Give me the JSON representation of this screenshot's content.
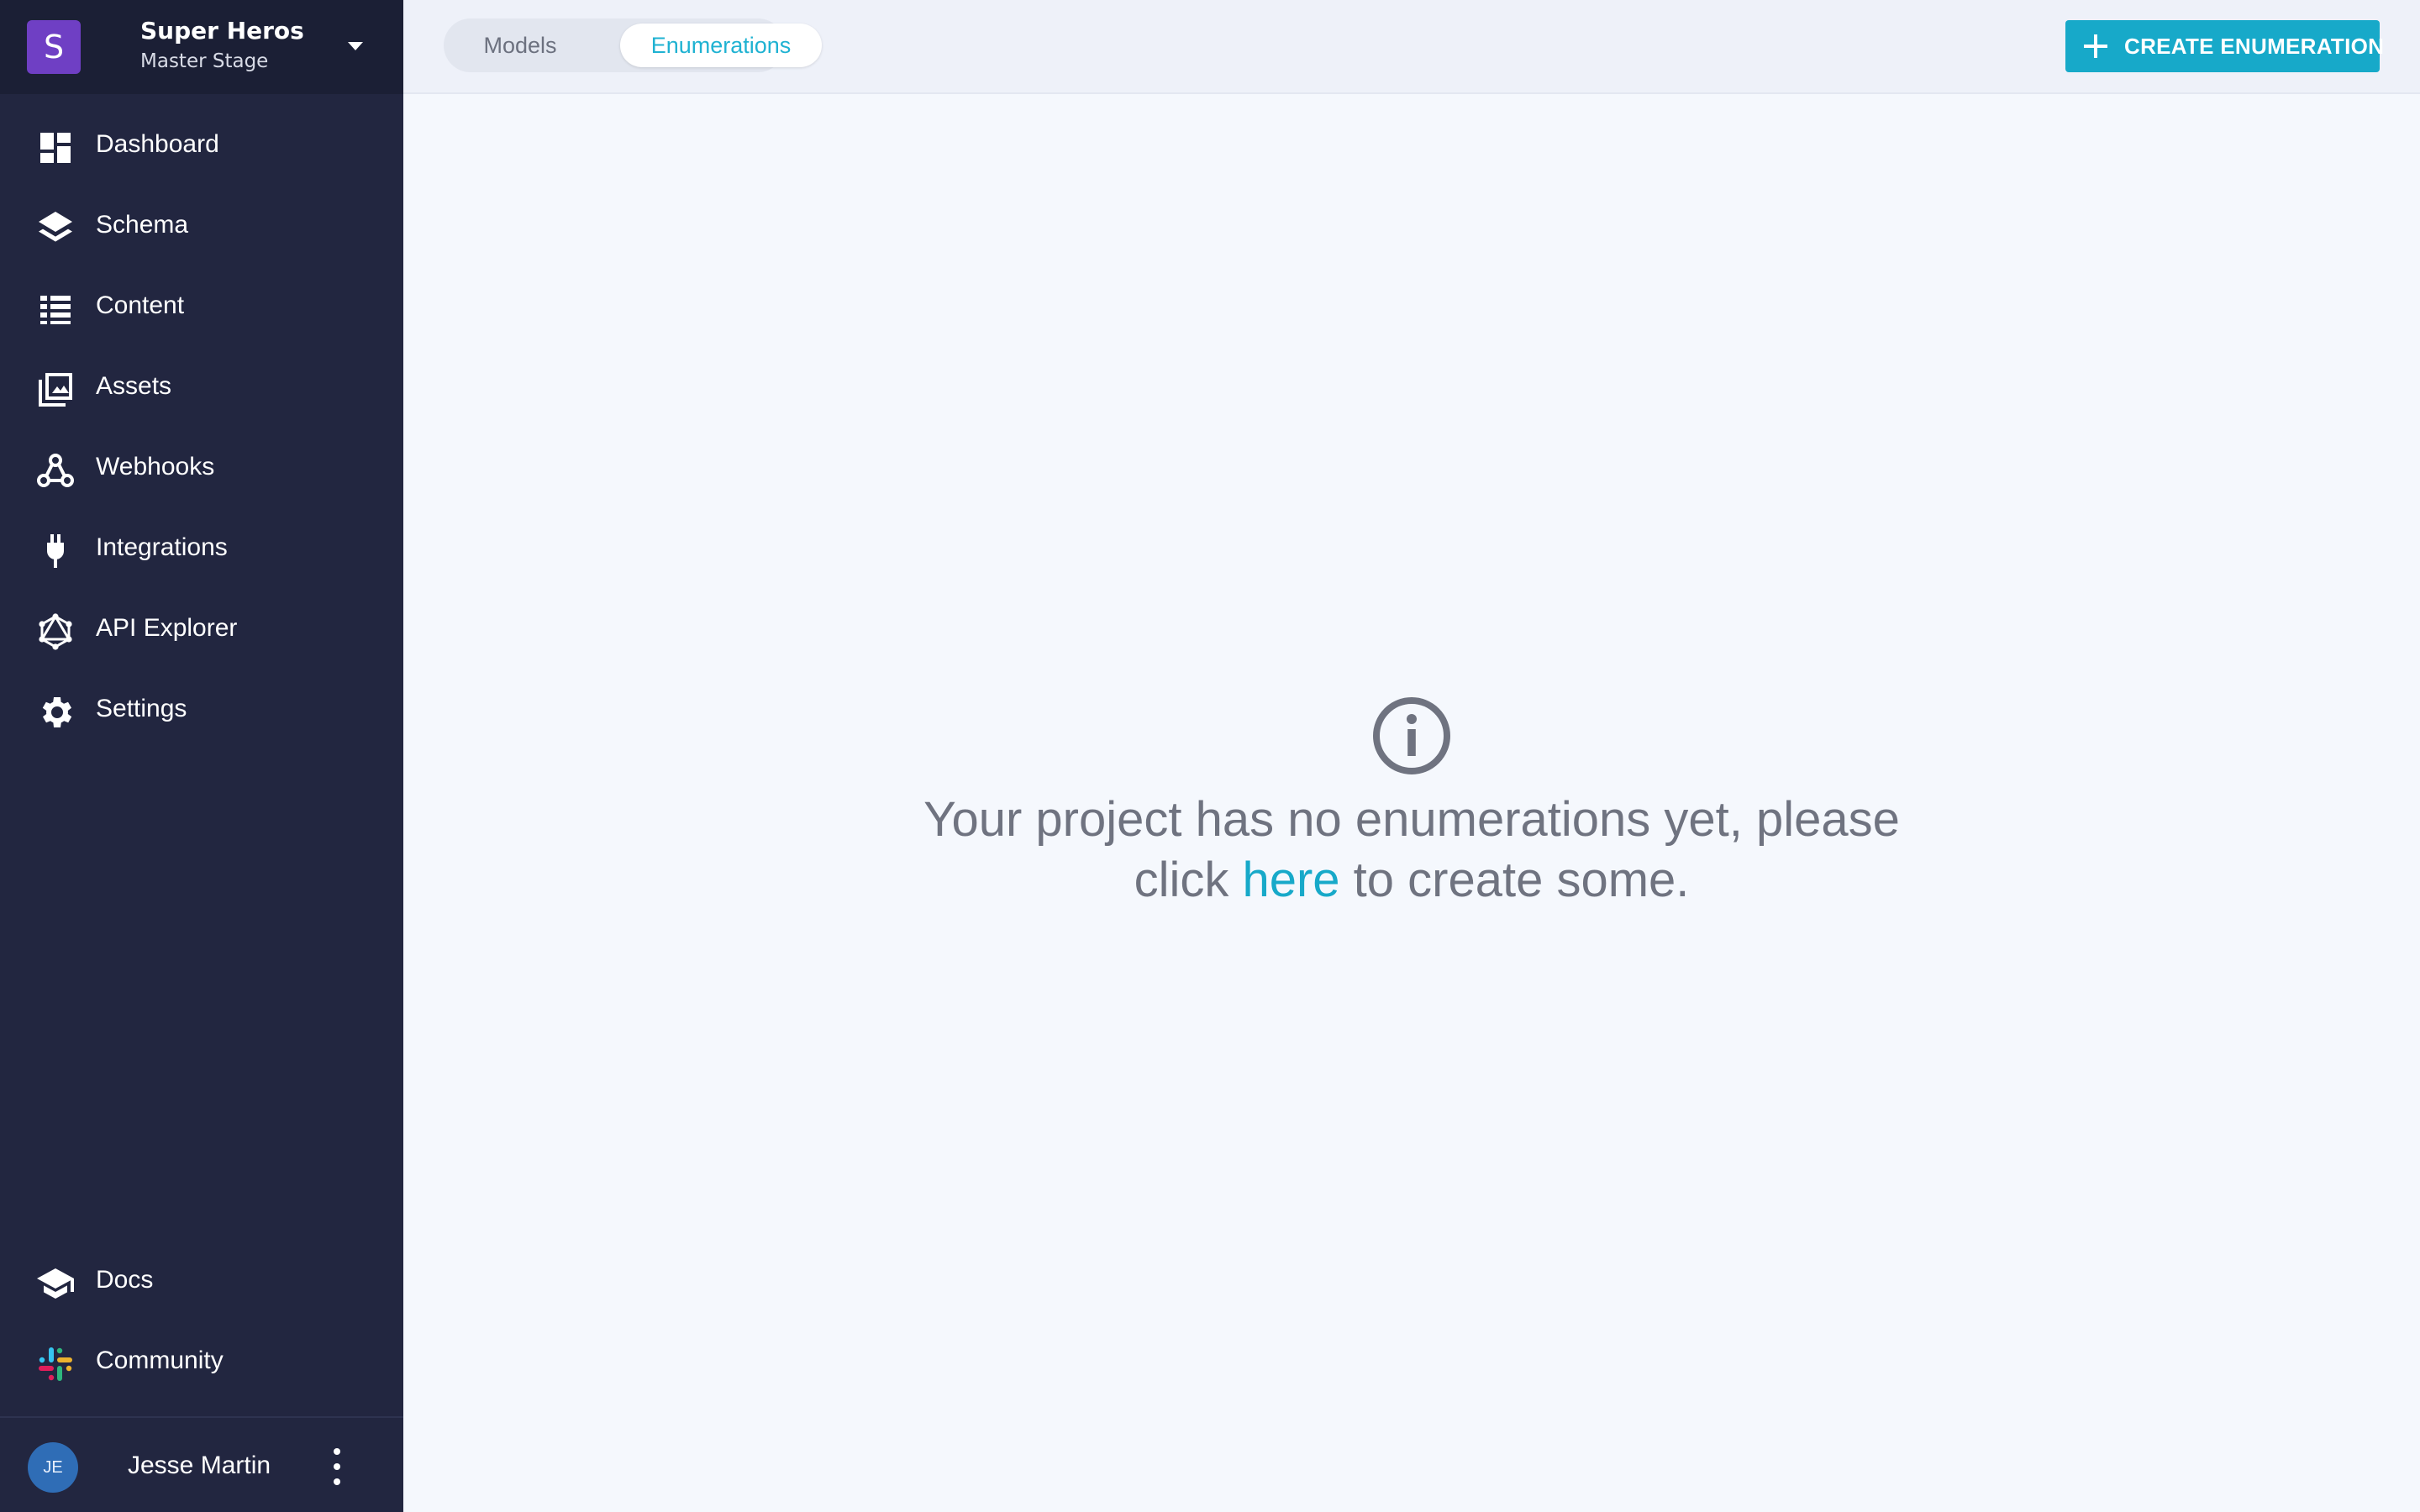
{
  "project": {
    "avatar_letter": "S",
    "name": "Super Heros",
    "stage": "Master Stage"
  },
  "nav": {
    "items": [
      {
        "label": "Dashboard",
        "icon": "dashboard-icon"
      },
      {
        "label": "Schema",
        "icon": "layers-icon"
      },
      {
        "label": "Content",
        "icon": "list-icon"
      },
      {
        "label": "Assets",
        "icon": "images-icon"
      },
      {
        "label": "Webhooks",
        "icon": "webhook-icon"
      },
      {
        "label": "Integrations",
        "icon": "plug-icon"
      },
      {
        "label": "API Explorer",
        "icon": "graphql-icon"
      },
      {
        "label": "Settings",
        "icon": "gear-icon"
      }
    ],
    "footer_items": [
      {
        "label": "Docs",
        "icon": "graduation-cap-icon"
      },
      {
        "label": "Community",
        "icon": "slack-icon"
      }
    ]
  },
  "user": {
    "initials": "JE",
    "name": "Jesse Martin"
  },
  "tabs": [
    {
      "label": "Models",
      "active": false
    },
    {
      "label": "Enumerations",
      "active": true
    }
  ],
  "toolbar": {
    "create_label": "CREATE ENUMERATION"
  },
  "empty_state": {
    "line1": "Your project has no enumerations yet, please",
    "before_link": "click ",
    "link": "here",
    "after_link": " to create some."
  },
  "colors": {
    "sidebar_bg": "#222640",
    "accent": "#17a9c9",
    "project_avatar": "#6f3fc4",
    "user_avatar": "#2f6db6"
  }
}
